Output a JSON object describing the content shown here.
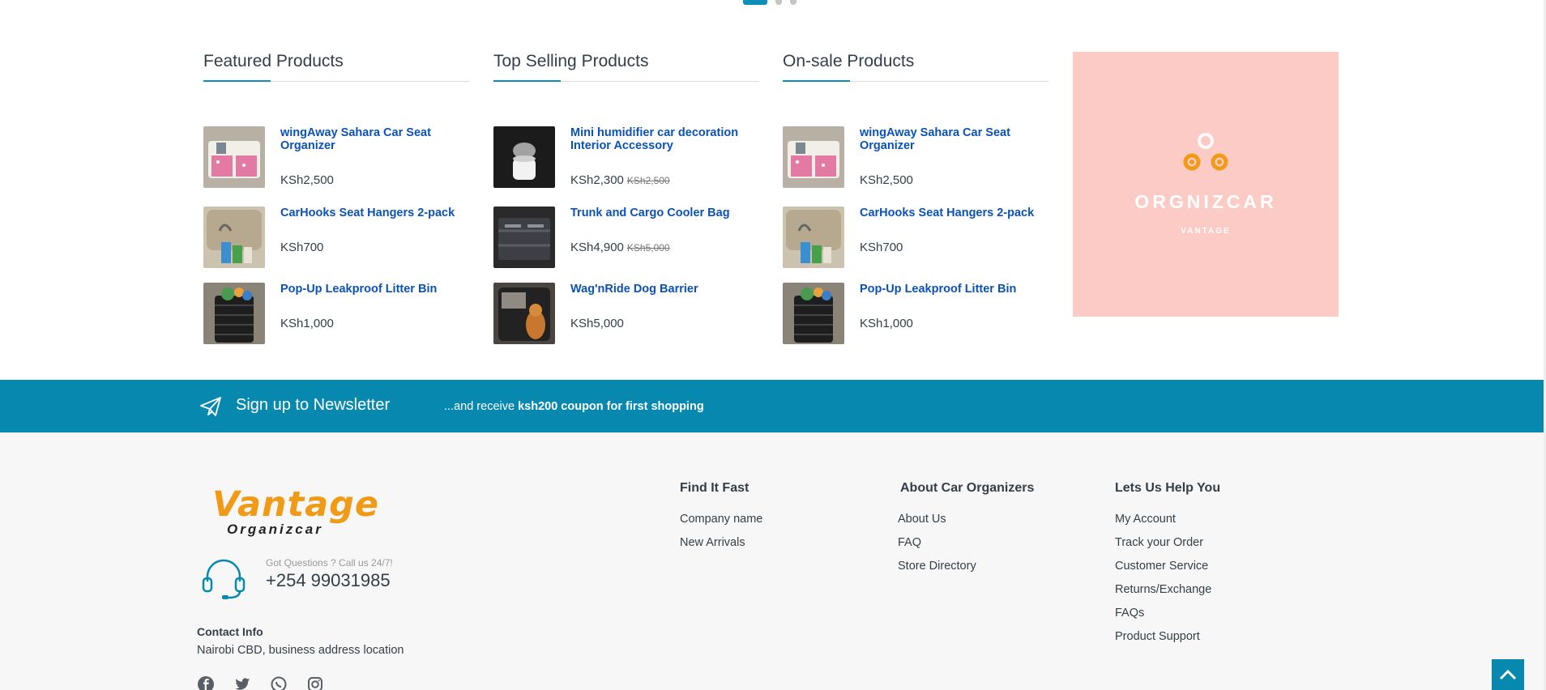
{
  "columns": [
    {
      "title": "Featured Products",
      "products": [
        {
          "name": "wingAway Sahara Car Seat Organizer",
          "price": "KSh2,500",
          "old_price": ""
        },
        {
          "name": "CarHooks Seat Hangers 2-pack",
          "price": "KSh700",
          "old_price": ""
        },
        {
          "name": "Pop-Up Leakproof Litter Bin",
          "price": "KSh1,000",
          "old_price": ""
        }
      ]
    },
    {
      "title": "Top Selling Products",
      "products": [
        {
          "name": "Mini humidifier car decoration Interior Accessory",
          "price": "KSh2,300",
          "old_price": "KSh2,500"
        },
        {
          "name": "Trunk and Cargo Cooler Bag",
          "price": "KSh4,900",
          "old_price": "KSh5,000"
        },
        {
          "name": "Wag'nRide Dog Barrier",
          "price": "KSh5,000",
          "old_price": ""
        }
      ]
    },
    {
      "title": "On-sale Products",
      "products": [
        {
          "name": "wingAway Sahara Car Seat Organizer",
          "price": "KSh2,500",
          "old_price": ""
        },
        {
          "name": "CarHooks Seat Hangers 2-pack",
          "price": "KSh700",
          "old_price": ""
        },
        {
          "name": "Pop-Up Leakproof Litter Bin",
          "price": "KSh1,000",
          "old_price": ""
        }
      ]
    }
  ],
  "ad": {
    "title": "ORGNIZCAR",
    "subtitle": "VANTAGE"
  },
  "newsletter": {
    "title": "Sign up to Newsletter",
    "desc_prefix": "...and receive ",
    "desc_bold": "ksh200 coupon for first shopping"
  },
  "footer": {
    "logo_main": "Vantage",
    "logo_sub": "Organizcar",
    "support_question": "Got Questions ? Call us 24/7!",
    "phone": "+254 99031985",
    "contact_heading": "Contact Info",
    "contact_text": "Nairobi CBD, business address location",
    "socials": [
      "facebook-icon",
      "twitter-icon",
      "whatsapp-icon",
      "instagram-icon"
    ],
    "columns": [
      {
        "heading": "Find It Fast",
        "links": [
          "Company name",
          "New Arrivals"
        ]
      },
      {
        "heading": "About Car Organizers",
        "links": [
          "About Us",
          "FAQ",
          "Store Directory"
        ]
      },
      {
        "heading": "Lets Us Help You",
        "links": [
          "My Account",
          "Track your Order",
          "Customer Service",
          "Returns/Exchange",
          "FAQs",
          "Product Support"
        ]
      }
    ]
  },
  "colors": {
    "accent": "#0789af",
    "link": "#0a52b8",
    "ad_bg": "#fdcbc5",
    "logo_orange": "#f09a16"
  }
}
